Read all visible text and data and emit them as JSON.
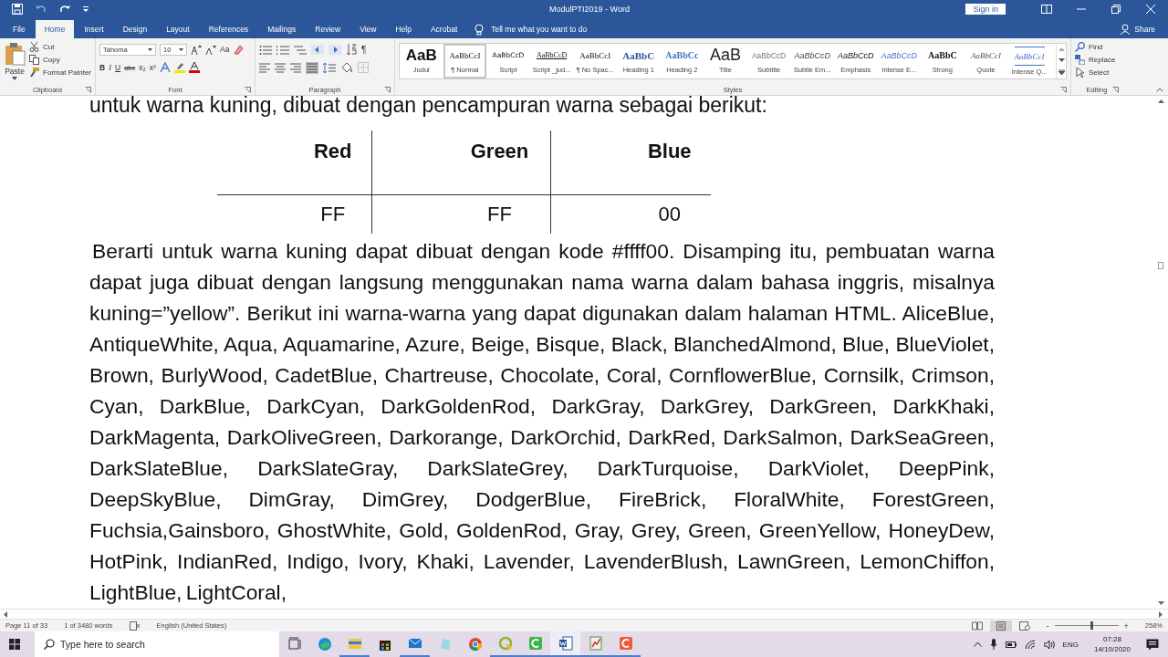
{
  "window": {
    "title": "ModulPTI2019 - Word",
    "sign_in": "Sign in"
  },
  "tabs": [
    {
      "label": "File",
      "selected": false
    },
    {
      "label": "Home",
      "selected": true
    },
    {
      "label": "Insert",
      "selected": false
    },
    {
      "label": "Design",
      "selected": false
    },
    {
      "label": "Layout",
      "selected": false
    },
    {
      "label": "References",
      "selected": false
    },
    {
      "label": "Mailings",
      "selected": false
    },
    {
      "label": "Review",
      "selected": false
    },
    {
      "label": "View",
      "selected": false
    },
    {
      "label": "Help",
      "selected": false
    },
    {
      "label": "Acrobat",
      "selected": false
    }
  ],
  "tell_me": {
    "placeholder": "Tell me what you want to do"
  },
  "share": "Share",
  "ribbon": {
    "clipboard": {
      "paste": "Paste",
      "cut": "Cut",
      "copy": "Copy",
      "format_painter": "Format Painter",
      "label": "Clipboard"
    },
    "font": {
      "font_name": "Tahoma",
      "font_size": "10",
      "format_buttons": [
        "B",
        "I",
        "U",
        "abc",
        "x₂",
        "x²"
      ],
      "change_case": "Aa",
      "label": "Font"
    },
    "paragraph": {
      "pilcrow": "¶",
      "label": "Paragraph"
    },
    "styles": {
      "label": "Styles",
      "items": [
        {
          "sample": "AaB",
          "name": "Judul",
          "kind": "judul",
          "selected": false
        },
        {
          "sample": "AaBbCcI",
          "name": "¶ Normal",
          "kind": "normal",
          "selected": true
        },
        {
          "sample": "AaBbCcD",
          "name": "Script",
          "kind": "script",
          "selected": false
        },
        {
          "sample": "AaBbCcD",
          "name": "Script _jud...",
          "kind": "underlined",
          "selected": false
        },
        {
          "sample": "AaBbCcI",
          "name": "¶ No Spac...",
          "kind": "normal",
          "selected": false
        },
        {
          "sample": "AaBbC",
          "name": "Heading 1",
          "kind": "heading1",
          "selected": false
        },
        {
          "sample": "AaBbCc",
          "name": "Heading 2",
          "kind": "heading2",
          "selected": false
        },
        {
          "sample": "AaB",
          "name": "Title",
          "kind": "title",
          "selected": false
        },
        {
          "sample": "AaBbCcD",
          "name": "Subtitle",
          "kind": "subtitle",
          "selected": false
        },
        {
          "sample": "AaBbCcD",
          "name": "Subtle Em...",
          "kind": "subtle",
          "selected": false
        },
        {
          "sample": "AaBbCcD",
          "name": "Emphasis",
          "kind": "emphasis",
          "selected": false
        },
        {
          "sample": "AaBbCcD",
          "name": "Intense E...",
          "kind": "intense",
          "selected": false
        },
        {
          "sample": "AaBbC",
          "name": "Strong",
          "kind": "strong",
          "selected": false
        },
        {
          "sample": "AaBbCcI",
          "name": "Quote",
          "kind": "quote",
          "selected": false
        },
        {
          "sample": "AaBbCcI",
          "name": "Intense Q...",
          "kind": "intenseq",
          "selected": false
        }
      ]
    },
    "editing": {
      "find": "Find",
      "replace": "Replace",
      "select": "Select",
      "label": "Editing"
    }
  },
  "document": {
    "intro": "untuk warna kuning, dibuat dengan pencampuran warna sebagai berikut:",
    "table": {
      "columns": [
        "Red",
        "Green",
        "Blue"
      ],
      "rows": [
        [
          "FF",
          "FF",
          "00"
        ]
      ]
    },
    "paragraph": "Berarti untuk warna kuning dapat dibuat dengan kode #ffff00. Disamping itu, pembuatan warna dapat juga dibuat dengan langsung menggunakan nama warna dalam bahasa inggris, misalnya kuning=”yellow”. Berikut ini warna-warna yang dapat digunakan dalam halaman HTML. AliceBlue, AntiqueWhite, Aqua, Aquamarine, Azure, Beige, Bisque, Black, BlanchedAlmond, Blue, BlueViolet, Brown, BurlyWood, CadetBlue, Chartreuse, Chocolate, Coral, CornflowerBlue, Cornsilk, Crimson, Cyan, DarkBlue, DarkCyan, DarkGoldenRod, DarkGray, DarkGrey, DarkGreen, DarkKhaki, DarkMagenta, DarkOliveGreen, Darkorange, DarkOrchid, DarkRed, DarkSalmon, DarkSeaGreen, DarkSlateBlue, DarkSlateGray, DarkSlateGrey, DarkTurquoise, DarkViolet, DeepPink, DeepSkyBlue, DimGray, DimGrey, DodgerBlue, FireBrick, FloralWhite, ForestGreen, Fuchsia,Gainsboro, GhostWhite, Gold, GoldenRod, Gray, Grey, Green, GreenYellow, HoneyDew, HotPink, IndianRed, Indigo, Ivory, Khaki, Lavender, LavenderBlush, LawnGreen, LemonChiffon, LightBlue, LightCoral,"
  },
  "status_bar": {
    "page": "Page 11 of 33",
    "words": "1 of 3480 words",
    "language": "English (United States)",
    "zoom_out": "-",
    "zoom_in": "+",
    "zoom": {
      "level": 0.58
    },
    "zoom_reading": "258%"
  },
  "taskbar": {
    "search": {
      "placeholder": "Type here to search"
    },
    "language": "ENG",
    "time": "07:28",
    "date": "14/10/2020"
  }
}
